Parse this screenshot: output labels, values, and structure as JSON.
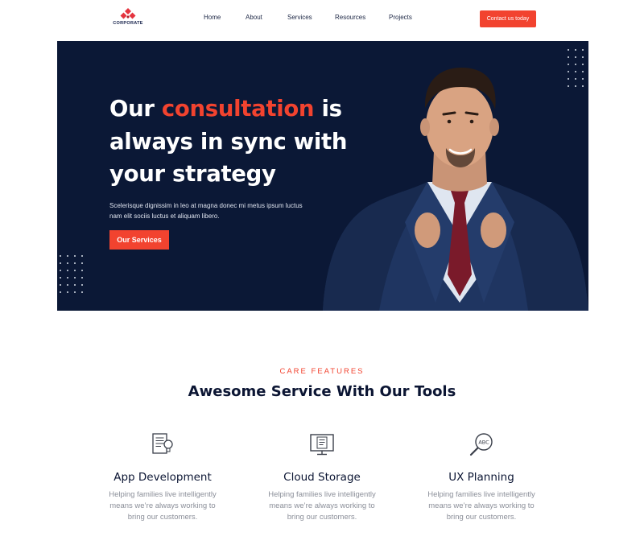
{
  "brand": {
    "name": "CORPORATE",
    "accent": "#f2432f",
    "navy": "#0b1836"
  },
  "nav": {
    "items": [
      {
        "label": "Home"
      },
      {
        "label": "About"
      },
      {
        "label": "Services"
      },
      {
        "label": "Resources"
      },
      {
        "label": "Projects"
      }
    ],
    "cta_label": "Contact us today"
  },
  "hero": {
    "title_prefix": "Our",
    "title_accent": "consultation",
    "title_rest": "is always in sync with your strategy",
    "subtitle": "Scelerisque dignissim in leo at magna donec mi metus ipsum luctus nam elit sociis luctus et aliquam libero.",
    "button_label": "Our Services",
    "image": "businessman-adjusting-suit-photo"
  },
  "features_section": {
    "eyebrow": "CARE FEATURES",
    "title": "Awesome Service With Our Tools",
    "items": [
      {
        "icon": "document-bulb-icon",
        "title": "App Development",
        "description": "Helping families live intelligently means we’re always working to bring our customers."
      },
      {
        "icon": "monitor-document-icon",
        "title": "Cloud Storage",
        "description": "Helping families live intelligently means we’re always working to bring our customers."
      },
      {
        "icon": "magnifier-abc-icon",
        "title": "UX Planning",
        "description": "Helping families live intelligently means we’re always working to bring our customers."
      }
    ]
  }
}
